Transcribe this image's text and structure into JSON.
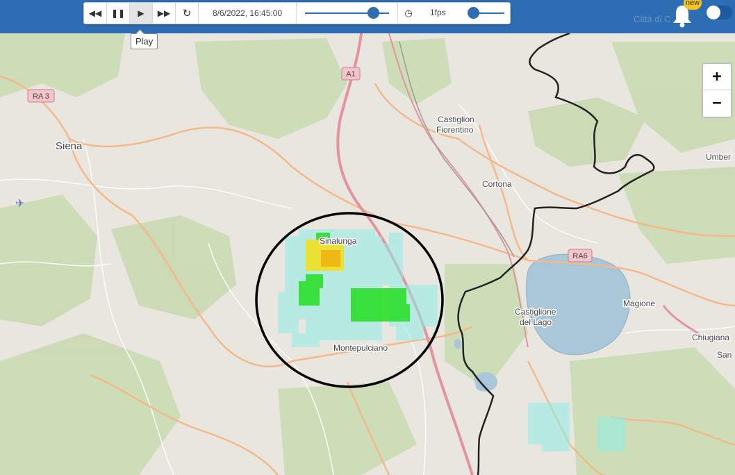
{
  "player": {
    "rewind_icon": "rewind-icon",
    "pause_icon": "pause-icon",
    "play_icon": "play-icon",
    "fast_forward_icon": "fast-forward-icon",
    "reload_icon": "reload-icon",
    "timestamp": "8/6/2022, 16:45:00",
    "time_position": 0.87,
    "clock_icon": "clock-icon",
    "fps_label": "1fps",
    "fps_position": 0.0,
    "tooltip": "Play"
  },
  "header": {
    "watermark": "Città di C",
    "badge": "new",
    "accent_color": "#2d6db3"
  },
  "zoom": {
    "in_label": "+",
    "out_label": "−"
  },
  "map": {
    "place_labels": {
      "siena": "Siena",
      "castiglion": "Castiglion",
      "fiorentino": "Fiorentino",
      "cortona": "Cortona",
      "sinalunga": "Sinalunga",
      "montepulciano": "Montepulciano",
      "castiglione": "Castiglione",
      "del_lago": "del Lago",
      "magione": "Magione",
      "chiugiana": "Chiugiana",
      "san": "San",
      "umber": "Umber"
    },
    "road_shields": {
      "a1": "A1",
      "ra3": "RA 3",
      "ra6": "RA6"
    },
    "airport_icon": "airplane-icon",
    "colors": {
      "land": "#e9e6df",
      "forest": "#c9dcb3",
      "lake": "#a9c7d9",
      "highway": "#e3939d",
      "primary_road": "#f3b98a",
      "border": "#222222",
      "radar_light": "#8feee6",
      "radar_green": "#2ce02c",
      "radar_yellow": "#f0e020",
      "radar_orange": "#f0b010",
      "annotation_circle": "#000000"
    }
  }
}
